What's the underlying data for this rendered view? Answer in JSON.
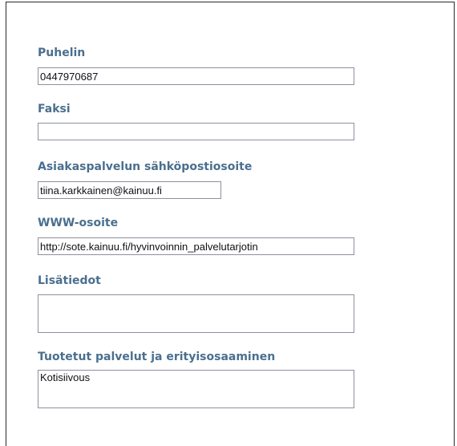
{
  "form": {
    "phone": {
      "label": "Puhelin",
      "value": "0447970687"
    },
    "fax": {
      "label": "Faksi",
      "value": ""
    },
    "email": {
      "label": "Asiakaspalvelun sähköpostiosoite",
      "value": "tiina.karkkainen@kainuu.fi"
    },
    "www": {
      "label": "WWW-osoite",
      "value": "http://sote.kainuu.fi/hyvinvoinnin_palvelutarjotin"
    },
    "info": {
      "label": "Lisätiedot",
      "value": ""
    },
    "services": {
      "label": "Tuotetut palvelut ja erityisosaaminen",
      "value": "Kotisiivous"
    }
  }
}
